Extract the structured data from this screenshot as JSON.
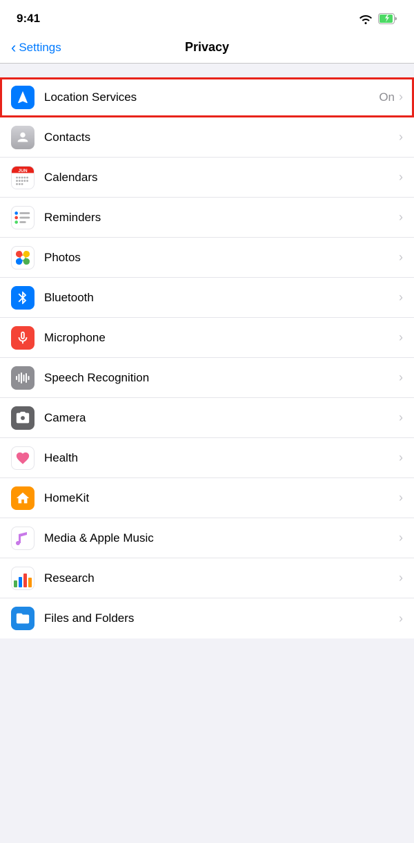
{
  "statusBar": {
    "time": "9:41"
  },
  "navBar": {
    "backLabel": "Settings",
    "title": "Privacy"
  },
  "listItems": [
    {
      "id": "location-services",
      "label": "Location Services",
      "value": "On",
      "highlighted": true,
      "iconType": "location"
    },
    {
      "id": "contacts",
      "label": "Contacts",
      "value": "",
      "highlighted": false,
      "iconType": "contacts"
    },
    {
      "id": "calendars",
      "label": "Calendars",
      "value": "",
      "highlighted": false,
      "iconType": "calendars"
    },
    {
      "id": "reminders",
      "label": "Reminders",
      "value": "",
      "highlighted": false,
      "iconType": "reminders"
    },
    {
      "id": "photos",
      "label": "Photos",
      "value": "",
      "highlighted": false,
      "iconType": "photos"
    },
    {
      "id": "bluetooth",
      "label": "Bluetooth",
      "value": "",
      "highlighted": false,
      "iconType": "bluetooth"
    },
    {
      "id": "microphone",
      "label": "Microphone",
      "value": "",
      "highlighted": false,
      "iconType": "microphone"
    },
    {
      "id": "speech-recognition",
      "label": "Speech Recognition",
      "value": "",
      "highlighted": false,
      "iconType": "speech"
    },
    {
      "id": "camera",
      "label": "Camera",
      "value": "",
      "highlighted": false,
      "iconType": "camera"
    },
    {
      "id": "health",
      "label": "Health",
      "value": "",
      "highlighted": false,
      "iconType": "health"
    },
    {
      "id": "homekit",
      "label": "HomeKit",
      "value": "",
      "highlighted": false,
      "iconType": "homekit"
    },
    {
      "id": "media-apple-music",
      "label": "Media & Apple Music",
      "value": "",
      "highlighted": false,
      "iconType": "music"
    },
    {
      "id": "research",
      "label": "Research",
      "value": "",
      "highlighted": false,
      "iconType": "research"
    },
    {
      "id": "files-folders",
      "label": "Files and Folders",
      "value": "",
      "highlighted": false,
      "iconType": "files"
    }
  ]
}
